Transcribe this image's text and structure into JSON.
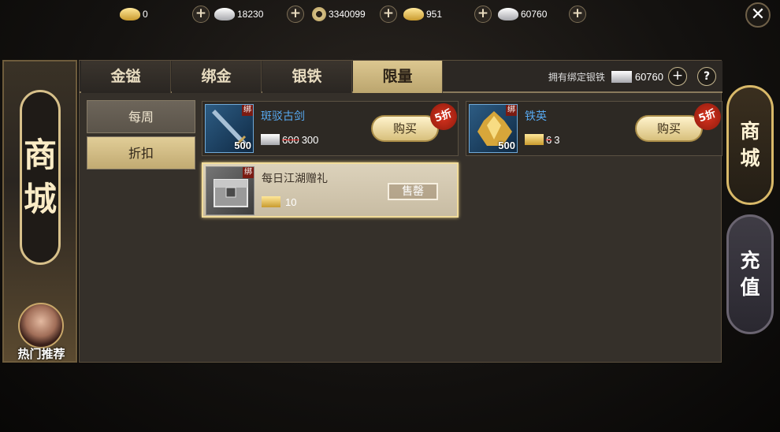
{
  "currencies": [
    {
      "icon": "gold-ingot-icon",
      "value": "0"
    },
    {
      "icon": "silver-ingot-icon",
      "value": "18230"
    },
    {
      "icon": "copper-coin-icon",
      "value": "3340099"
    },
    {
      "icon": "bound-gold-icon",
      "value": "951"
    },
    {
      "icon": "bound-silver-icon",
      "value": "60760"
    }
  ],
  "banner": {
    "title_1": "商",
    "title_2": "城",
    "hot_label": "热门推荐"
  },
  "tabs": [
    "金镒",
    "绑金",
    "银铁",
    "限量"
  ],
  "active_tab": "限量",
  "owned": {
    "label": "拥有绑定银铁",
    "value": "60760",
    "plus": "+",
    "help": "?"
  },
  "subtabs": [
    "每周",
    "折扣"
  ],
  "active_subtab": "折扣",
  "items": [
    {
      "name": "斑驳古剑",
      "bind": "绑",
      "qty": "500",
      "old_price": "600",
      "new_price": "300",
      "buy_label": "购买",
      "discount": "5折"
    },
    {
      "name": "铁英",
      "bind": "绑",
      "qty": "500",
      "old_price": "6",
      "new_price": "3",
      "buy_label": "购买",
      "discount": "5折"
    },
    {
      "name": "每日江湖赠礼",
      "bind": "绑",
      "price": "10",
      "sold_label": "售罄"
    }
  ],
  "side": {
    "shop_1": "商",
    "shop_2": "城",
    "recharge_1": "充",
    "recharge_2": "值"
  },
  "close_label": "✕"
}
